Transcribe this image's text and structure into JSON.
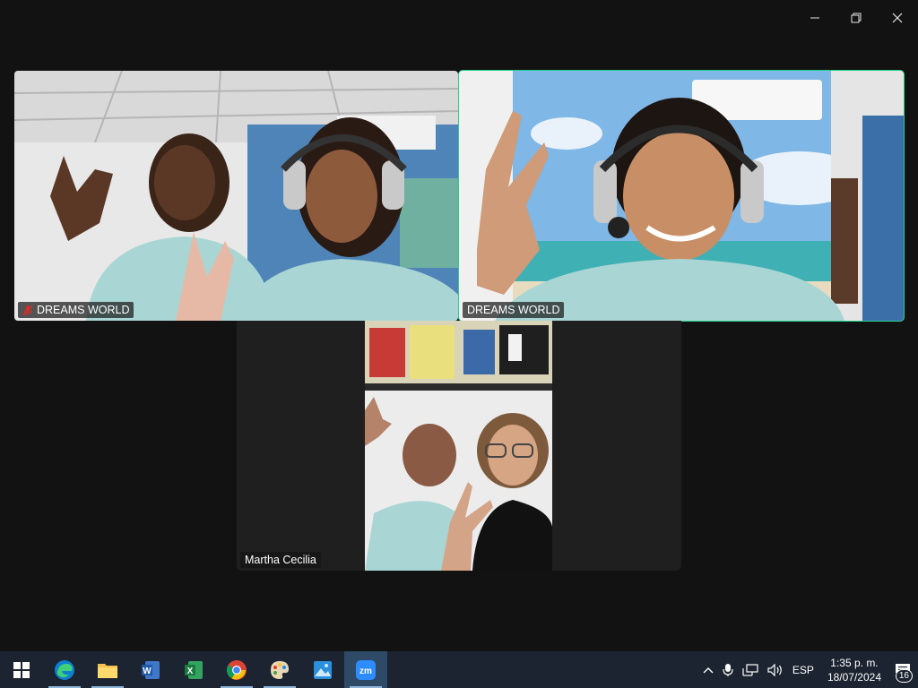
{
  "window": {
    "controls": [
      "minimize-icon",
      "restore-icon",
      "close-icon"
    ]
  },
  "participants": [
    {
      "name": "DREAMS WORLD",
      "muted": true,
      "active_speaker": false
    },
    {
      "name": "DREAMS WORLD",
      "muted": false,
      "active_speaker": true
    },
    {
      "name": "Martha Cecilia",
      "muted": false,
      "active_speaker": false
    }
  ],
  "colors": {
    "background": "#121212",
    "tile_background": "#1f1f1f",
    "active_speaker_border": "#23d18b",
    "taskbar": "#1b2430",
    "mute_icon": "#e02828"
  },
  "taskbar": {
    "apps": [
      {
        "name": "start",
        "icon": "windows-logo-icon"
      },
      {
        "name": "edge",
        "icon": "edge-icon"
      },
      {
        "name": "file-explorer",
        "icon": "folder-icon"
      },
      {
        "name": "word",
        "icon": "word-icon",
        "letter": "W"
      },
      {
        "name": "excel",
        "icon": "excel-icon",
        "letter": "X"
      },
      {
        "name": "chrome",
        "icon": "chrome-icon"
      },
      {
        "name": "paint",
        "icon": "palette-icon"
      },
      {
        "name": "photos",
        "icon": "photos-icon"
      },
      {
        "name": "zoom",
        "icon": "zoom-icon",
        "letter": "zm"
      }
    ],
    "tray": {
      "language": "ESP",
      "time": "1:35 p. m.",
      "date": "18/07/2024",
      "notifications": "16"
    }
  }
}
